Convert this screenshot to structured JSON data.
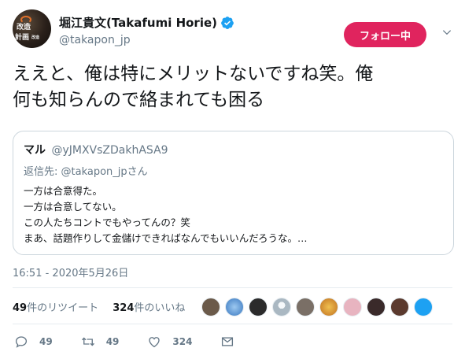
{
  "author": {
    "display_name": "堀江貴文(Takafumi Horie)",
    "handle": "@takapon_jp",
    "avatar_text": [
      "改造",
      "計画",
      "改造",
      "計画"
    ],
    "verified_icon": "verified-badge-icon"
  },
  "follow_button": {
    "label": "フォロー中",
    "color": "#e0245e"
  },
  "menu_icon": "chevron-down-icon",
  "tweet": {
    "lines": [
      "ええと、俺は特にメリットないですね笑。俺",
      "何も知らんので絡まれても困る"
    ]
  },
  "quoted_tweet": {
    "name": "マル",
    "handle": "@yJMXVsZDakhASA9",
    "reply_prefix": "返信先: ",
    "reply_handle": "@takapon_jp",
    "reply_suffix": "さん",
    "lines": [
      "一方は合意得た。",
      "一方は合意してない。",
      "この人たちコントでもやってんの？笑",
      "まあ、話題作りして金儲けできればなんでもいいんだろうな。…"
    ]
  },
  "timestamp": "16:51 - 2020年5月26日",
  "stats": {
    "retweets_count": "49",
    "retweets_label": "件のリツイート",
    "likes_count": "324",
    "likes_label": "件のいいね"
  },
  "likers": [
    {
      "icon": "liker-avatar-1",
      "color": "#6b5a4a"
    },
    {
      "icon": "liker-avatar-2",
      "color": "#4a90d9"
    },
    {
      "icon": "liker-avatar-3",
      "color": "#2b2b2b"
    },
    {
      "icon": "liker-avatar-4",
      "color": "#aab8c2"
    },
    {
      "icon": "liker-avatar-5",
      "color": "#7a6f66"
    },
    {
      "icon": "liker-avatar-6",
      "color": "#d9902a"
    },
    {
      "icon": "liker-avatar-7",
      "color": "#e8b4c0"
    },
    {
      "icon": "liker-avatar-8",
      "color": "#3a2a2a"
    },
    {
      "icon": "liker-avatar-9",
      "color": "#5b3a2e"
    },
    {
      "icon": "liker-avatar-10",
      "color": "#1da1f2"
    }
  ],
  "actions": {
    "reply_icon": "reply-icon",
    "reply_count": "49",
    "retweet_icon": "retweet-icon",
    "retweet_count": "49",
    "like_icon": "heart-icon",
    "like_count": "324",
    "dm_icon": "envelope-icon"
  }
}
